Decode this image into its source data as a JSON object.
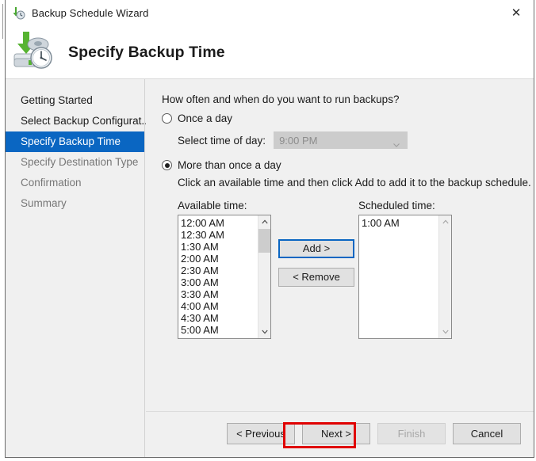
{
  "window": {
    "title": "Backup Schedule Wizard",
    "title_icon": "backup-clock-icon",
    "close_label": "✕"
  },
  "header": {
    "title": "Specify Backup Time",
    "icon": "disk-drive-clock-icon"
  },
  "sidebar": {
    "items": [
      {
        "label": "Getting Started",
        "state": "done"
      },
      {
        "label": "Select Backup Configurat...",
        "state": "done"
      },
      {
        "label": "Specify Backup Time",
        "state": "active"
      },
      {
        "label": "Specify Destination Type",
        "state": "pending"
      },
      {
        "label": "Confirmation",
        "state": "pending"
      },
      {
        "label": "Summary",
        "state": "pending"
      }
    ]
  },
  "main": {
    "prompt": "How often and when do you want to run backups?",
    "once_a_day": {
      "label": "Once a day",
      "checked": false,
      "time_label": "Select time of day:",
      "time_value": "9:00 PM",
      "disabled": true
    },
    "more_than_once": {
      "label": "More than once a day",
      "checked": true,
      "hint": "Click an available time and then click Add to add it to the backup schedule."
    },
    "available": {
      "label": "Available time:",
      "items": [
        "12:00 AM",
        "12:30 AM",
        "1:30 AM",
        "2:00 AM",
        "2:30 AM",
        "3:00 AM",
        "3:30 AM",
        "4:00 AM",
        "4:30 AM",
        "5:00 AM"
      ]
    },
    "scheduled": {
      "label": "Scheduled time:",
      "items": [
        "1:00 AM"
      ]
    },
    "add_button": "Add >",
    "remove_button": "< Remove"
  },
  "footer": {
    "previous": "< Previous",
    "next": "Next >",
    "finish": "Finish",
    "cancel": "Cancel"
  },
  "colors": {
    "accent_blue": "#0a66c2",
    "highlight_red": "#e00000",
    "window_bg": "#f0f0f0"
  }
}
